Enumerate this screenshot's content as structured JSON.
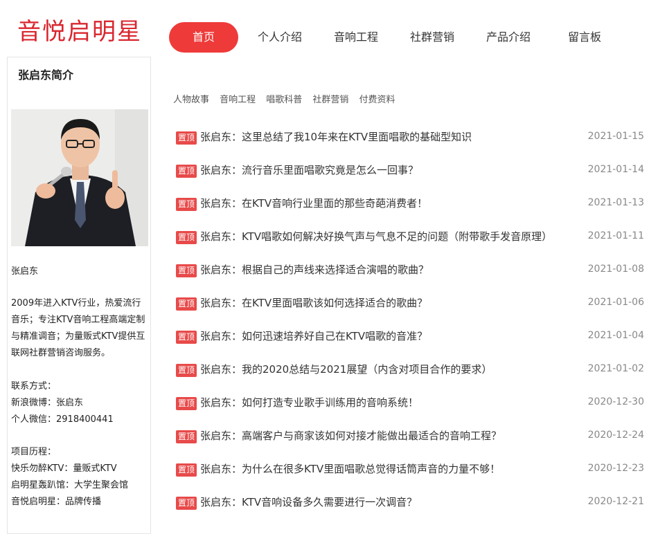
{
  "header": {
    "logo": "音悦启明星",
    "nav": [
      {
        "label": "首页",
        "active": true
      },
      {
        "label": "个人介绍"
      },
      {
        "label": "音响工程"
      },
      {
        "label": "社群营销"
      },
      {
        "label": "产品介绍"
      },
      {
        "label": "留言板"
      }
    ]
  },
  "sidebar": {
    "title": "张启东简介",
    "name": "张启东",
    "bio": "2009年进入KTV行业，热爱流行音乐；专注KTV音响工程高端定制与精准调音；为量贩式KTV提供互联网社群营销咨询服务。",
    "contact_label": "联系方式：",
    "weibo": "新浪微博：张启东",
    "wechat": "个人微信：2918400441",
    "history_label": "项目历程：",
    "history": [
      "快乐勿醉KTV：量贩式KTV",
      "启明星轰趴馆：大学生聚会馆",
      "音悦启明星：品牌传播"
    ]
  },
  "categories": [
    "人物故事",
    "音响工程",
    "唱歌科普",
    "社群营销",
    "付费资料"
  ],
  "articles": [
    {
      "badge": "置顶",
      "title": "张启东：这里总结了我10年来在KTV里面唱歌的基础型知识",
      "date": "2021-01-15"
    },
    {
      "badge": "置顶",
      "title": "张启东：流行音乐里面唱歌究竟是怎么一回事？",
      "date": "2021-01-14"
    },
    {
      "badge": "置顶",
      "title": "张启东：在KTV音响行业里面的那些奇葩消费者！",
      "date": "2021-01-13"
    },
    {
      "badge": "置顶",
      "title": "张启东：KTV唱歌如何解决好换气声与气息不足的问题（附带歌手发音原理）",
      "date": "2021-01-11"
    },
    {
      "badge": "置顶",
      "title": "张启东：根据自己的声线来选择适合演唱的歌曲？",
      "date": "2021-01-08"
    },
    {
      "badge": "置顶",
      "title": "张启东：在KTV里面唱歌该如何选择适合的歌曲？",
      "date": "2021-01-06"
    },
    {
      "badge": "置顶",
      "title": "张启东：如何迅速培养好自己在KTV唱歌的音准？",
      "date": "2021-01-04"
    },
    {
      "badge": "置顶",
      "title": "张启东：我的2020总结与2021展望（内含对项目合作的要求）",
      "date": "2021-01-02"
    },
    {
      "badge": "置顶",
      "title": "张启东：如何打造专业歌手训练用的音响系统！",
      "date": "2020-12-30"
    },
    {
      "badge": "置顶",
      "title": "张启东：高端客户与商家该如何对接才能做出最适合的音响工程？",
      "date": "2020-12-24"
    },
    {
      "badge": "置顶",
      "title": "张启东：为什么在很多KTV里面唱歌总觉得话筒声音的力量不够！",
      "date": "2020-12-23"
    },
    {
      "badge": "置顶",
      "title": "张启东：KTV音响设备多久需要进行一次调音？",
      "date": "2020-12-21"
    }
  ]
}
